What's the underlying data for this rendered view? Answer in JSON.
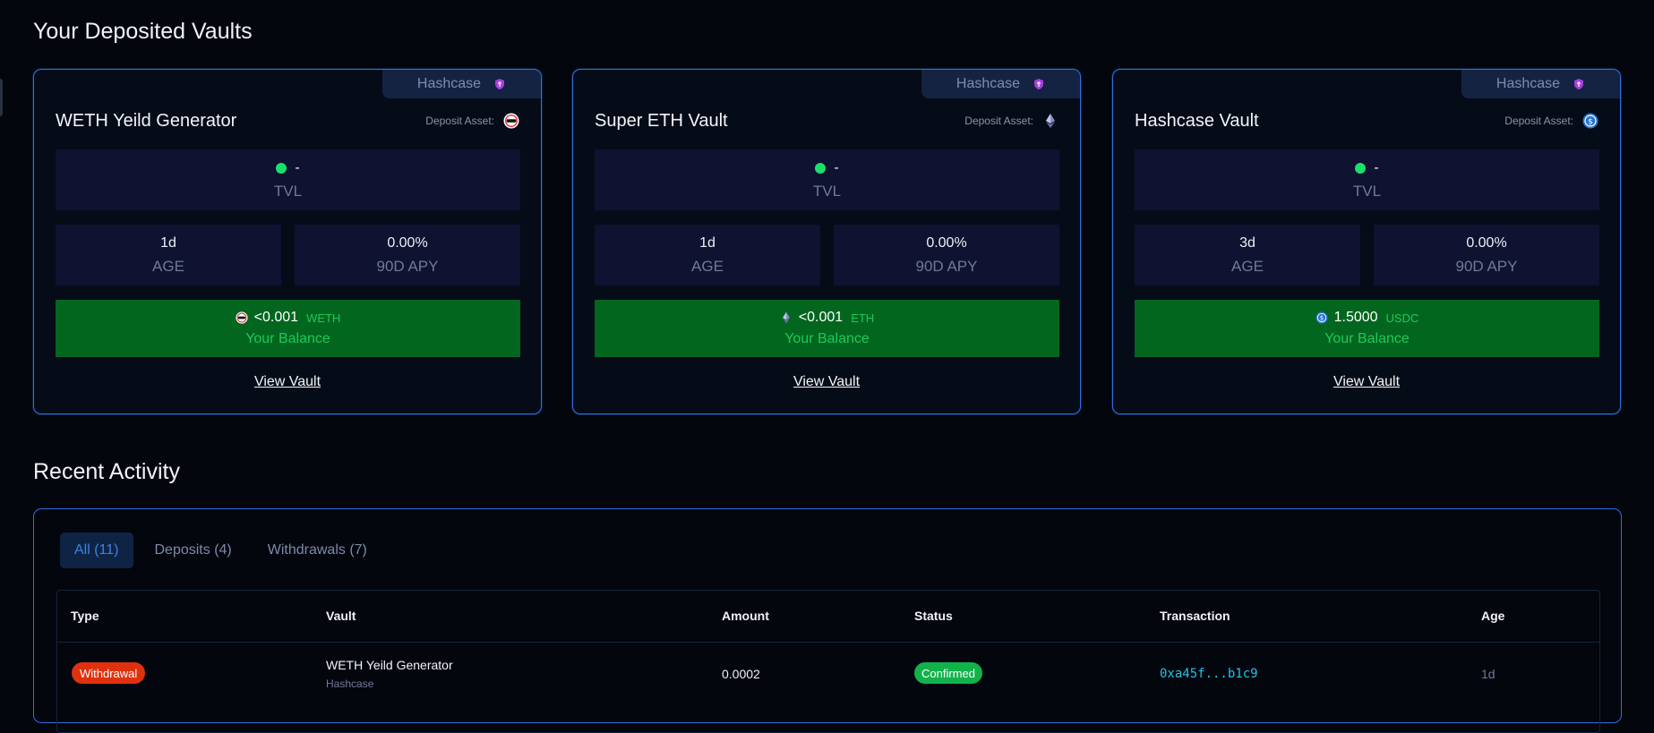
{
  "deposited": {
    "title": "Your Deposited Vaults",
    "vaults": [
      {
        "provider": "Hashcase",
        "name": "WETH Yeild Generator",
        "deposit_label": "Deposit Asset:",
        "asset_icon": "weth-icon",
        "tvl_value": "-",
        "tvl_label": "TVL",
        "age_value": "1d",
        "age_label": "AGE",
        "apy_value": "0.00%",
        "apy_label": "90D APY",
        "balance_amount": "<0.001",
        "balance_symbol": "WETH",
        "balance_label": "Your Balance",
        "view_label": "View Vault"
      },
      {
        "provider": "Hashcase",
        "name": "Super ETH Vault",
        "deposit_label": "Deposit Asset:",
        "asset_icon": "eth-icon",
        "tvl_value": "-",
        "tvl_label": "TVL",
        "age_value": "1d",
        "age_label": "AGE",
        "apy_value": "0.00%",
        "apy_label": "90D APY",
        "balance_amount": "<0.001",
        "balance_symbol": "ETH",
        "balance_label": "Your Balance",
        "view_label": "View Vault"
      },
      {
        "provider": "Hashcase",
        "name": "Hashcase Vault",
        "deposit_label": "Deposit Asset:",
        "asset_icon": "usdc-icon",
        "tvl_value": "-",
        "tvl_label": "TVL",
        "age_value": "3d",
        "age_label": "AGE",
        "apy_value": "0.00%",
        "apy_label": "90D APY",
        "balance_amount": "1.5000",
        "balance_symbol": "USDC",
        "balance_label": "Your Balance",
        "view_label": "View Vault"
      }
    ]
  },
  "activity": {
    "title": "Recent Activity",
    "tabs": [
      "All (11)",
      "Deposits (4)",
      "Withdrawals (7)"
    ],
    "active_tab": "All (11)",
    "columns": [
      "Type",
      "Vault",
      "Amount",
      "Status",
      "Transaction",
      "Age"
    ],
    "rows": [
      {
        "type": "Withdrawal",
        "vault": "WETH Yeild Generator",
        "provider": "Hashcase",
        "amount": "0.0002",
        "status": "Confirmed",
        "tx": "0xa45f...b1c9",
        "age": "1d"
      }
    ]
  },
  "colors": {
    "accent_border": "#2f6fe0",
    "balance_bg": "#03661f",
    "withdrawal_badge": "#e0310f",
    "confirmed_badge": "#12b24a",
    "tx_link": "#22c3e6"
  }
}
